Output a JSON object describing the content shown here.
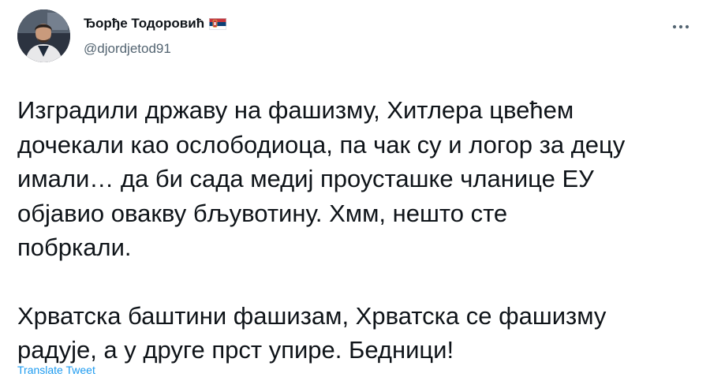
{
  "tweet": {
    "display_name": "Ђорђе Тодоровић",
    "flag_icon": "serbia-flag-icon",
    "handle": "@djordjetod91",
    "more_icon": "more-options-icon",
    "paragraphs": [
      "Изградили државу на фашизму, Хитлера цвећем\nдочекали као ослободиоца, па чак су и логор за децу\nимали… да би сада медиј проусташке чланице ЕУ\nобјавио овакву бљувотину. Хмм, нешто сте\nпобркали.",
      "Хрватска баштини фашизам, Хрватска се фашизму\nрадује, а у друге прст упире. Бедници!"
    ],
    "translate_label": "Translate Tweet"
  },
  "colors": {
    "text": "#0f1419",
    "secondary": "#536471",
    "link": "#1d9bf0"
  }
}
